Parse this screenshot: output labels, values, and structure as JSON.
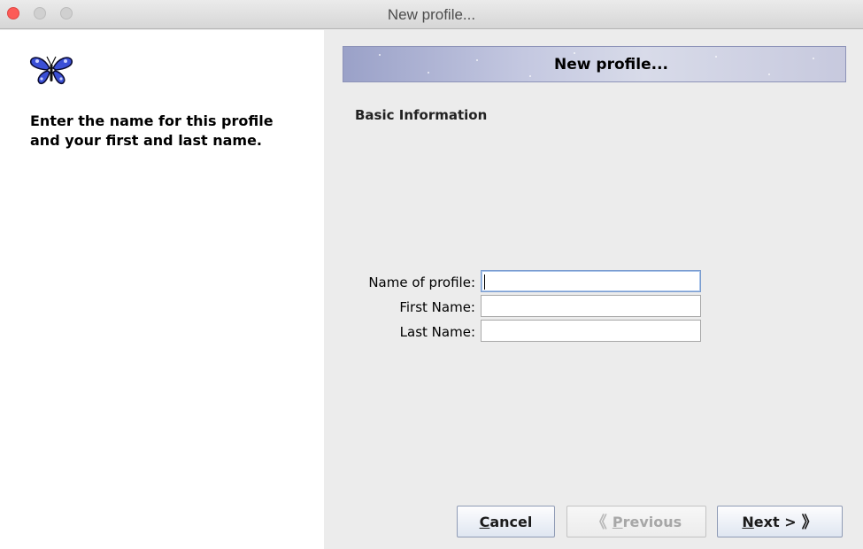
{
  "window": {
    "title": "New profile..."
  },
  "sidebar": {
    "icon": "butterfly-icon",
    "instructions_line1": "Enter the name for this profile",
    "instructions_line2": "and your first and last name."
  },
  "banner": {
    "title": "New profile..."
  },
  "form": {
    "section_title": "Basic Information",
    "fields": [
      {
        "label": "Name of profile:",
        "value": ""
      },
      {
        "label": "First Name:",
        "value": ""
      },
      {
        "label": "Last Name:",
        "value": ""
      }
    ]
  },
  "buttons": {
    "cancel": {
      "mnemonic": "C",
      "rest": "ancel"
    },
    "previous": {
      "chevron": "《",
      "mnemonic": "P",
      "rest": "revious",
      "enabled": false
    },
    "next": {
      "mnemonic": "N",
      "rest": "ext >",
      "chevron": "》"
    }
  },
  "colors": {
    "close_button": "#fc5b57",
    "banner_tint": "#c3c7e0",
    "butterfly_blue": "#3a4fd6"
  }
}
